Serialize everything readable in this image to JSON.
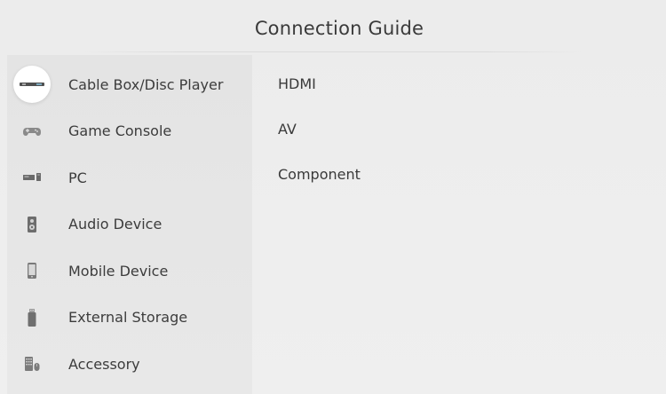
{
  "header": {
    "title": "Connection Guide"
  },
  "sidebar": {
    "selected_index": 0,
    "items": [
      {
        "label": "Cable Box/Disc Player",
        "icon": "cable-box-icon"
      },
      {
        "label": "Game Console",
        "icon": "gamepad-icon"
      },
      {
        "label": "PC",
        "icon": "pc-icon"
      },
      {
        "label": "Audio Device",
        "icon": "speaker-icon"
      },
      {
        "label": "Mobile Device",
        "icon": "mobile-phone-icon"
      },
      {
        "label": "External Storage",
        "icon": "usb-storage-icon"
      },
      {
        "label": "Accessory",
        "icon": "keyboard-mouse-icon"
      }
    ]
  },
  "content": {
    "options": [
      {
        "label": "HDMI"
      },
      {
        "label": "AV"
      },
      {
        "label": "Component"
      }
    ]
  },
  "colors": {
    "background": "#eeeeee",
    "sidebar": "#e5e5e5",
    "selected_highlight": "#ffffff",
    "text": "#3a3a3a"
  }
}
